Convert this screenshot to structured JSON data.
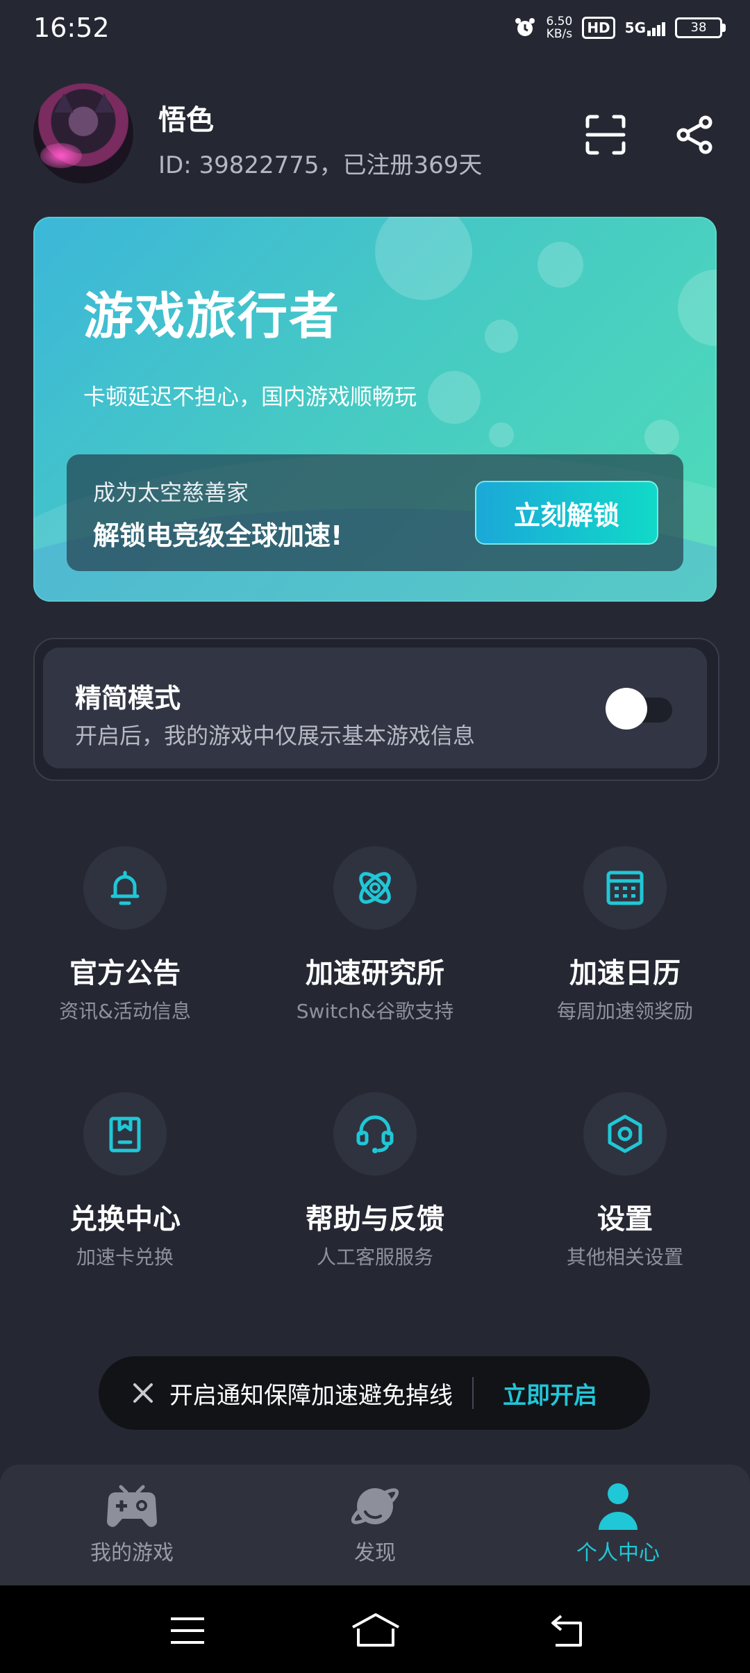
{
  "status_bar": {
    "time": "16:52",
    "net_speed_value": "6.50",
    "net_speed_unit": "KB/s",
    "hd_badge": "HD",
    "network": "5G",
    "battery": "38"
  },
  "profile": {
    "username": "悟色",
    "id_text": "ID: 39822775，已注册369天"
  },
  "promo": {
    "title": "游戏旅行者",
    "subtitle": "卡顿延迟不担心，国内游戏顺畅玩",
    "panel_line1": "成为太空慈善家",
    "panel_line2": "解锁电竞级全球加速!",
    "button": "立刻解锁"
  },
  "simple_mode": {
    "title": "精简模式",
    "description": "开启后，我的游戏中仅展示基本游戏信息",
    "enabled": false
  },
  "grid": [
    {
      "title": "官方公告",
      "subtitle": "资讯&活动信息",
      "icon": "bell-icon"
    },
    {
      "title": "加速研究所",
      "subtitle": "Switch&谷歌支持",
      "icon": "atom-icon"
    },
    {
      "title": "加速日历",
      "subtitle": "每周加速领奖励",
      "icon": "calendar-icon"
    },
    {
      "title": "兑换中心",
      "subtitle": "加速卡兑换",
      "icon": "gift-box-icon"
    },
    {
      "title": "帮助与反馈",
      "subtitle": "人工客服服务",
      "icon": "headset-icon"
    },
    {
      "title": "设置",
      "subtitle": "其他相关设置",
      "icon": "settings-icon"
    }
  ],
  "toast": {
    "text": "开启通知保障加速避免掉线",
    "action": "立即开启"
  },
  "bottom_nav": [
    {
      "label": "我的游戏",
      "icon": "gamepad-icon",
      "active": false
    },
    {
      "label": "发现",
      "icon": "planet-icon",
      "active": false
    },
    {
      "label": "个人中心",
      "icon": "person-icon",
      "active": true
    }
  ],
  "colors": {
    "background": "#252833",
    "accent": "#20c7d6",
    "card_gradient_start": "#3cb7d9",
    "card_gradient_end": "#4fdcb8"
  }
}
